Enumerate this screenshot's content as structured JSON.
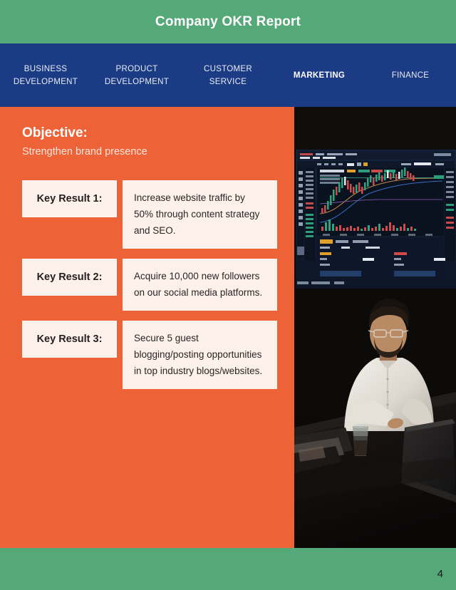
{
  "header": {
    "title": "Company OKR Report",
    "background_color": "#55a877"
  },
  "nav": {
    "background_color": "#1b3b85",
    "items": [
      {
        "lines": [
          "BUSINESS",
          "DEVELOPMENT"
        ],
        "active": false
      },
      {
        "lines": [
          "PRODUCT",
          "DEVELOPMENT"
        ],
        "active": false
      },
      {
        "lines": [
          "CUSTOMER",
          "SERVICE"
        ],
        "active": false
      },
      {
        "lines": [
          "MARKETING"
        ],
        "active": true
      },
      {
        "lines": [
          "FINANCE"
        ],
        "active": false
      }
    ]
  },
  "main": {
    "panel_color": "#ee6238",
    "card_color": "#fdf1ec",
    "objective_heading": "Objective:",
    "objective_text": "Strengthen brand presence",
    "key_results": [
      {
        "label": "Key Result 1:",
        "description": "Increase website traffic by 50% through content strategy and SEO."
      },
      {
        "label": "Key Result 2:",
        "description": "Acquire 10,000 new followers on our social media platforms."
      },
      {
        "label": "Key Result 3:",
        "description": "Secure 5 guest blogging/posting opportunities in top industry blogs/websites."
      }
    ]
  },
  "photo": {
    "description": "Man in white shirt working on a laptop at a dark desk with trading chart monitors behind him"
  },
  "footer": {
    "background_color": "#55a877",
    "page_number": "4"
  }
}
